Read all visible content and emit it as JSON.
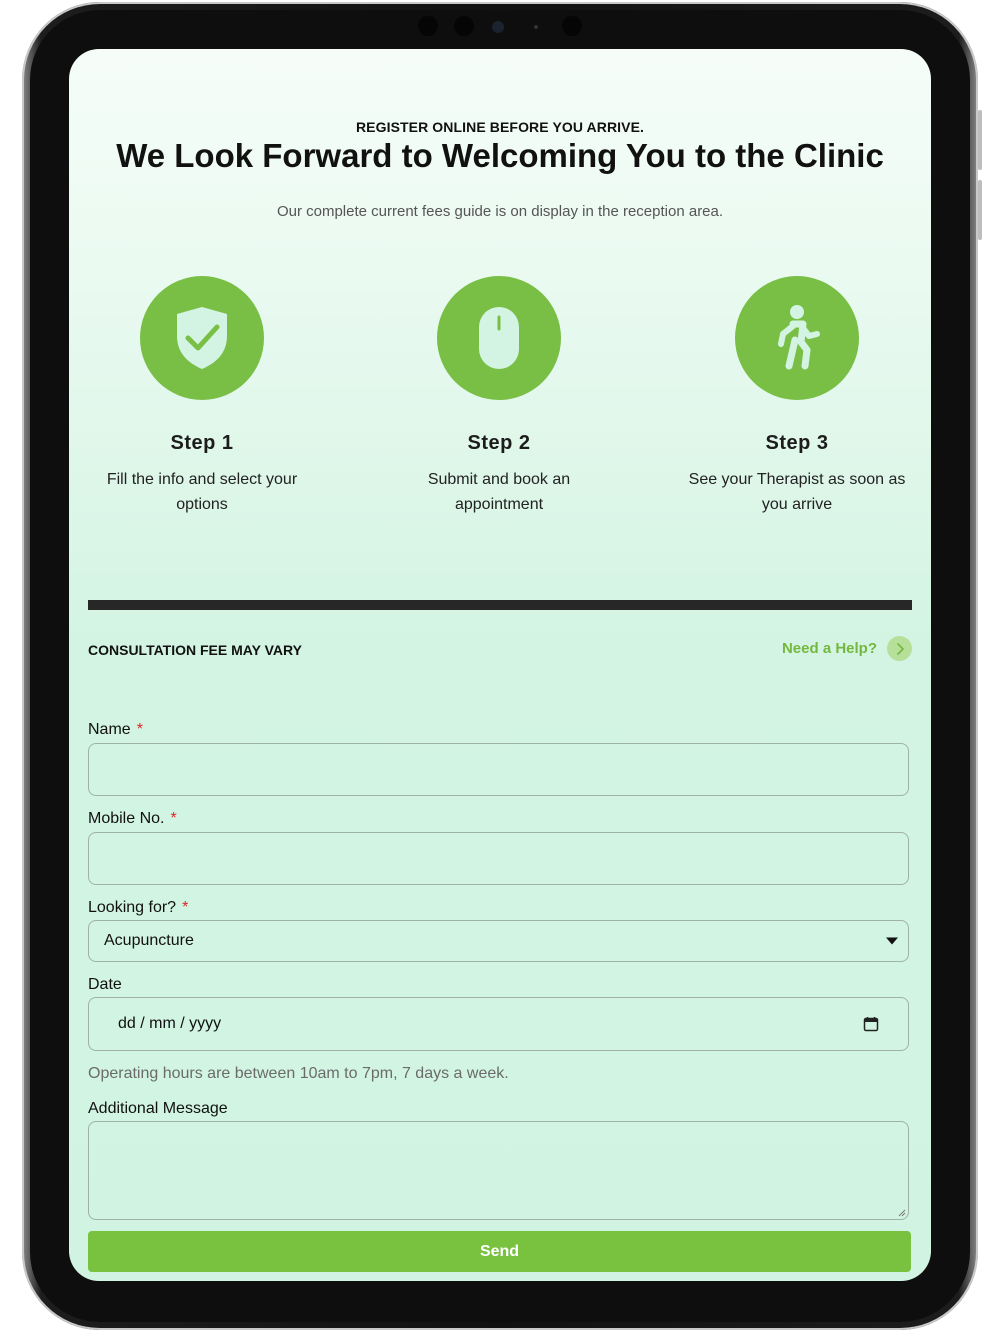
{
  "header": {
    "eyebrow": "REGISTER ONLINE BEFORE YOU ARRIVE.",
    "headline": "We Look Forward to Welcoming You to the Clinic",
    "fees_note": "Our complete current fees guide is on display in the reception area."
  },
  "steps": [
    {
      "icon": "shield-check-icon",
      "title": "Step 1",
      "line1": "Fill the info and select your",
      "line2": "options"
    },
    {
      "icon": "mouse-icon",
      "title": "Step 2",
      "line1": "Submit and book an",
      "line2": "appointment"
    },
    {
      "icon": "walking-person-icon",
      "title": "Step 3",
      "line1": "See your Therapist as soon as",
      "line2": "you arrive"
    }
  ],
  "form": {
    "fee_notice": "CONSULTATION FEE MAY VARY",
    "help_label": "Need a Help?",
    "required_mark": "*",
    "name_label": "Name",
    "name_value": "",
    "mobile_label": "Mobile No.",
    "mobile_value": "",
    "looking_label": "Looking for?",
    "looking_selected": "Acupuncture",
    "date_label": "Date",
    "date_placeholder": "dd / mm / yyyy",
    "hours_note": "Operating hours are between 10am to 7pm, 7 days a week.",
    "message_label": "Additional Message",
    "message_value": "",
    "send_label": "Send"
  },
  "colors": {
    "accent": "#79bf45",
    "help_text": "#75b83f",
    "required": "#e02424",
    "divider": "#272727",
    "background": "#d3f4e3"
  }
}
